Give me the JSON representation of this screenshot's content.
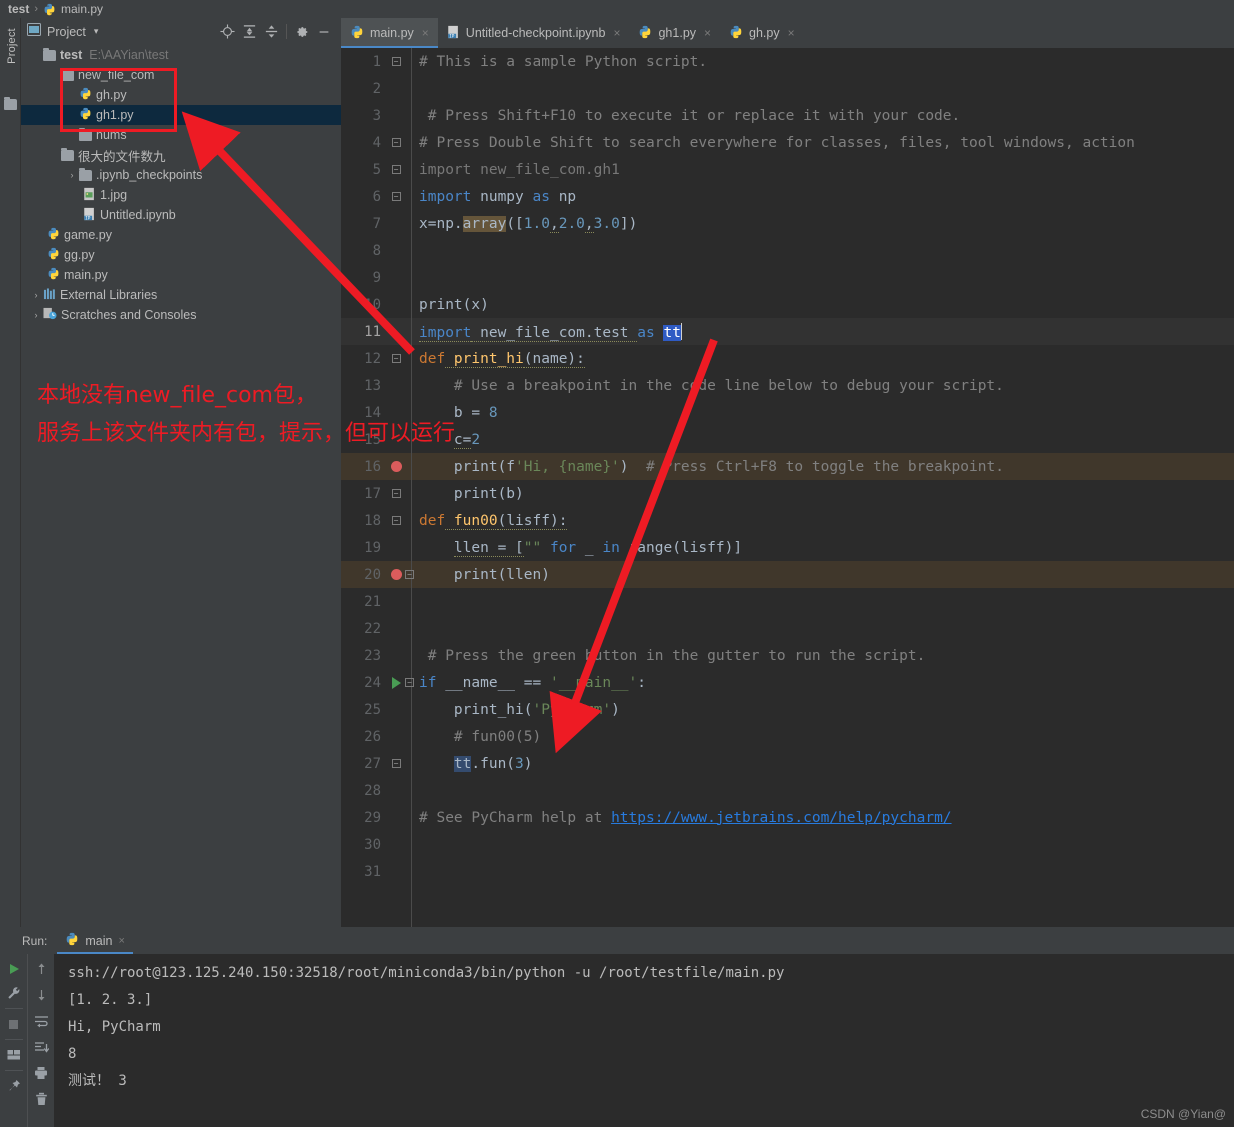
{
  "breadcrumb": {
    "root": "test",
    "separator": "›",
    "file": "main.py",
    "file_icon": "python-file-icon"
  },
  "tool_strip": {
    "label": "Project",
    "folder_icon": "folder-icon"
  },
  "project_panel": {
    "title": "Project",
    "chevron": "▾",
    "toolbar_icons": [
      "locate-target-icon",
      "expand-all-icon",
      "collapse-all-icon",
      "gear-icon",
      "minimize-icon"
    ],
    "tree": [
      {
        "depth": 0,
        "twisty": "ⱟ",
        "icon": "folder-icon",
        "label": "test",
        "bold": true,
        "path": "E:\\AAYian\\test",
        "selected": false
      },
      {
        "depth": 1,
        "twisty": "ⱟ",
        "icon": "folder-icon",
        "label": "new_file_com",
        "bold": false,
        "path": "",
        "selected": false
      },
      {
        "depth": 2,
        "twisty": "",
        "icon": "python-file-icon",
        "label": "gh.py",
        "bold": false,
        "path": "",
        "selected": false
      },
      {
        "depth": 2,
        "twisty": "",
        "icon": "python-file-icon",
        "label": "gh1.py",
        "bold": false,
        "path": "",
        "selected": true
      },
      {
        "depth": 2,
        "twisty": "",
        "icon": "folder-icon",
        "label": "nums",
        "bold": false,
        "path": "",
        "selected": false
      },
      {
        "depth": 1,
        "twisty": "ⱟ",
        "icon": "folder-icon",
        "label": "很大的文件数九",
        "bold": false,
        "path": "",
        "selected": false
      },
      {
        "depth": 2,
        "twisty": "›",
        "icon": "folder-icon",
        "label": ".ipynb_checkpoints",
        "bold": false,
        "path": "",
        "selected": false
      },
      {
        "depth": 2,
        "twisty": "",
        "icon": "image-file-icon",
        "label": "1.jpg",
        "bold": false,
        "path": "",
        "selected": false
      },
      {
        "depth": 2,
        "twisty": "",
        "icon": "ipynb-file-icon",
        "label": "Untitled.ipynb",
        "bold": false,
        "path": "",
        "selected": false
      },
      {
        "depth": 1,
        "twisty": "",
        "icon": "python-file-icon",
        "label": "game.py",
        "bold": false,
        "path": "",
        "selected": false
      },
      {
        "depth": 1,
        "twisty": "",
        "icon": "python-file-icon",
        "label": "gg.py",
        "bold": false,
        "path": "",
        "selected": false
      },
      {
        "depth": 1,
        "twisty": "",
        "icon": "python-file-icon",
        "label": "main.py",
        "bold": false,
        "path": "",
        "selected": false
      },
      {
        "depth": 0,
        "twisty": "›",
        "icon": "libraries-icon",
        "label": "External Libraries",
        "bold": false,
        "path": "",
        "selected": false
      },
      {
        "depth": 0,
        "twisty": "›",
        "icon": "scratches-icon",
        "label": "Scratches and Consoles",
        "bold": false,
        "path": "",
        "selected": false
      }
    ]
  },
  "editor": {
    "tabs": [
      {
        "label": "main.py",
        "icon": "python-file-icon",
        "active": true,
        "close": "×"
      },
      {
        "label": "Untitled-checkpoint.ipynb",
        "icon": "ipynb-file-icon",
        "active": false,
        "close": "×"
      },
      {
        "label": "gh1.py",
        "icon": "python-file-icon",
        "active": false,
        "close": "×"
      },
      {
        "label": "gh.py",
        "icon": "python-file-icon",
        "active": false,
        "close": "×"
      }
    ],
    "lines": [
      {
        "n": "1",
        "text": "# This is a sample Python script."
      },
      {
        "n": "2",
        "text": ""
      },
      {
        "n": "3",
        "text": " # Press Shift+F10 to execute it or replace it with your code."
      },
      {
        "n": "4",
        "text": "# Press Double Shift to search everywhere for classes, files, tool windows, action"
      },
      {
        "n": "5",
        "text": "import new_file_com.gh1"
      },
      {
        "n": "6",
        "text": "import numpy as np"
      },
      {
        "n": "7",
        "text": "x=np.array([1.0,2.0,3.0])"
      },
      {
        "n": "8",
        "text": ""
      },
      {
        "n": "9",
        "text": ""
      },
      {
        "n": "10",
        "text": "print(x)"
      },
      {
        "n": "11",
        "text": "import new_file_com.test as tt"
      },
      {
        "n": "12",
        "text": "def print_hi(name):"
      },
      {
        "n": "13",
        "text": "    # Use a breakpoint in the code line below to debug your script."
      },
      {
        "n": "14",
        "text": "    b = 8"
      },
      {
        "n": "15",
        "text": "    c=2"
      },
      {
        "n": "16",
        "text": "    print(f'Hi, {name}')  # Press Ctrl+F8 to toggle the breakpoint."
      },
      {
        "n": "17",
        "text": "    print(b)"
      },
      {
        "n": "18",
        "text": "def fun00(lisff):"
      },
      {
        "n": "19",
        "text": "    llen = [\"\" for _ in range(lisff)]"
      },
      {
        "n": "20",
        "text": "    print(llen)"
      },
      {
        "n": "21",
        "text": ""
      },
      {
        "n": "22",
        "text": ""
      },
      {
        "n": "23",
        "text": " # Press the green button in the gutter to run the script."
      },
      {
        "n": "24",
        "text": "if __name__ == '__main__':"
      },
      {
        "n": "25",
        "text": "    print_hi('PyCharm')"
      },
      {
        "n": "26",
        "text": "    # fun00(5)"
      },
      {
        "n": "27",
        "text": "    tt.fun(3)"
      },
      {
        "n": "28",
        "text": ""
      },
      {
        "n": "29",
        "text": "# See PyCharm help at https://www.jetbrains.com/help/pycharm/"
      },
      {
        "n": "30",
        "text": ""
      },
      {
        "n": "31",
        "text": ""
      }
    ],
    "tokens": {
      "l1_comment": "# This is a sample Python script.",
      "l3_comment": "# Press Shift+F10 to execute it or replace it with your code.",
      "l4_comment": "# Press Double Shift to search everywhere for classes, files, tool windows, action",
      "l5_import": "import",
      "l5_mod": " new_file_com.gh1",
      "l6_import": "import",
      "l6_mod": " numpy ",
      "l6_as": "as",
      "l6_np": " np",
      "l7_a": "x=np.",
      "l7_array": "array",
      "l7_b": "([",
      "l7_n1": "1.0",
      "l7_c1": ",",
      "l7_n2": "2.0",
      "l7_c2": ",",
      "l7_n3": "3.0",
      "l7_d": "])",
      "l10_print": "print(x)",
      "l11_import": "import",
      "l11_mod": " new_file_com.test ",
      "l11_as": "as",
      "l11_sp": " ",
      "l11_tt": "tt",
      "l12_def": "def",
      "l12_name": " print_hi",
      "l12_rest": "(name):",
      "l13_comment": "# Use a breakpoint in the code line below to debug your script.",
      "l14_a": "b = ",
      "l14_n": "8",
      "l15_a": "c=",
      "l15_n": "2",
      "l16_a": "print(f",
      "l16_str": "'Hi, {name}'",
      "l16_b": ")  ",
      "l16_comment": "# Press Ctrl+F8 to toggle the breakpoint.",
      "l17": "print(b)",
      "l18_def": "def",
      "l18_name": " fun00",
      "l18_rest": "(lisff):",
      "l19_a": "llen = [",
      "l19_str": "\"\"",
      "l19_for": " for",
      "l19_b": " _ ",
      "l19_in": "in",
      "l19_c": " range(lisff)]",
      "l20": "print(llen)",
      "l23_comment": "# Press the green button in the gutter to run the script.",
      "l24_if": "if",
      "l24_a": " __name__ == ",
      "l24_str": "'__main__'",
      "l24_b": ":",
      "l25_a": "print_hi(",
      "l25_str": "'PyCharm'",
      "l25_b": ")",
      "l26_comment": "# fun00(5)",
      "l27_tt": "tt",
      "l27_rest": ".fun(",
      "l27_n": "3",
      "l27_end": ")",
      "l29_comment": "# See PyCharm help at ",
      "l29_link": "https://www.jetbrains.com/help/pycharm/"
    },
    "breakpoint_lines": [
      "16",
      "20"
    ],
    "run_marker_line": "24",
    "current_line": "11"
  },
  "run_panel": {
    "label": "Run:",
    "tab": {
      "label": "main",
      "icon": "python-file-icon",
      "close": "×"
    },
    "left_icons": [
      "run-icon",
      "wrench-icon",
      "stop-icon",
      "layout-icon",
      "pin-icon"
    ],
    "right_icons": [
      "up-arrow-icon",
      "down-arrow-icon",
      "soft-wrap-icon",
      "scroll-to-end-icon",
      "print-icon",
      "trash-icon"
    ],
    "console_lines": [
      "ssh://root@123.125.240.150:32518/root/miniconda3/bin/python -u /root/testfile/main.py",
      "[1. 2. 3.]",
      "Hi, PyCharm",
      "8",
      "测试！ 3"
    ]
  },
  "annotations": {
    "color": "#ee1b24",
    "note_line1": "本地没有new_file_com包，",
    "note_line2": "服务上该文件夹内有包，提示，但可以运行",
    "arrow1": "arrow-to-tree-icon",
    "arrow2": "arrow-to-code-icon",
    "box": "highlight-box"
  },
  "watermark": "CSDN @Yian@"
}
